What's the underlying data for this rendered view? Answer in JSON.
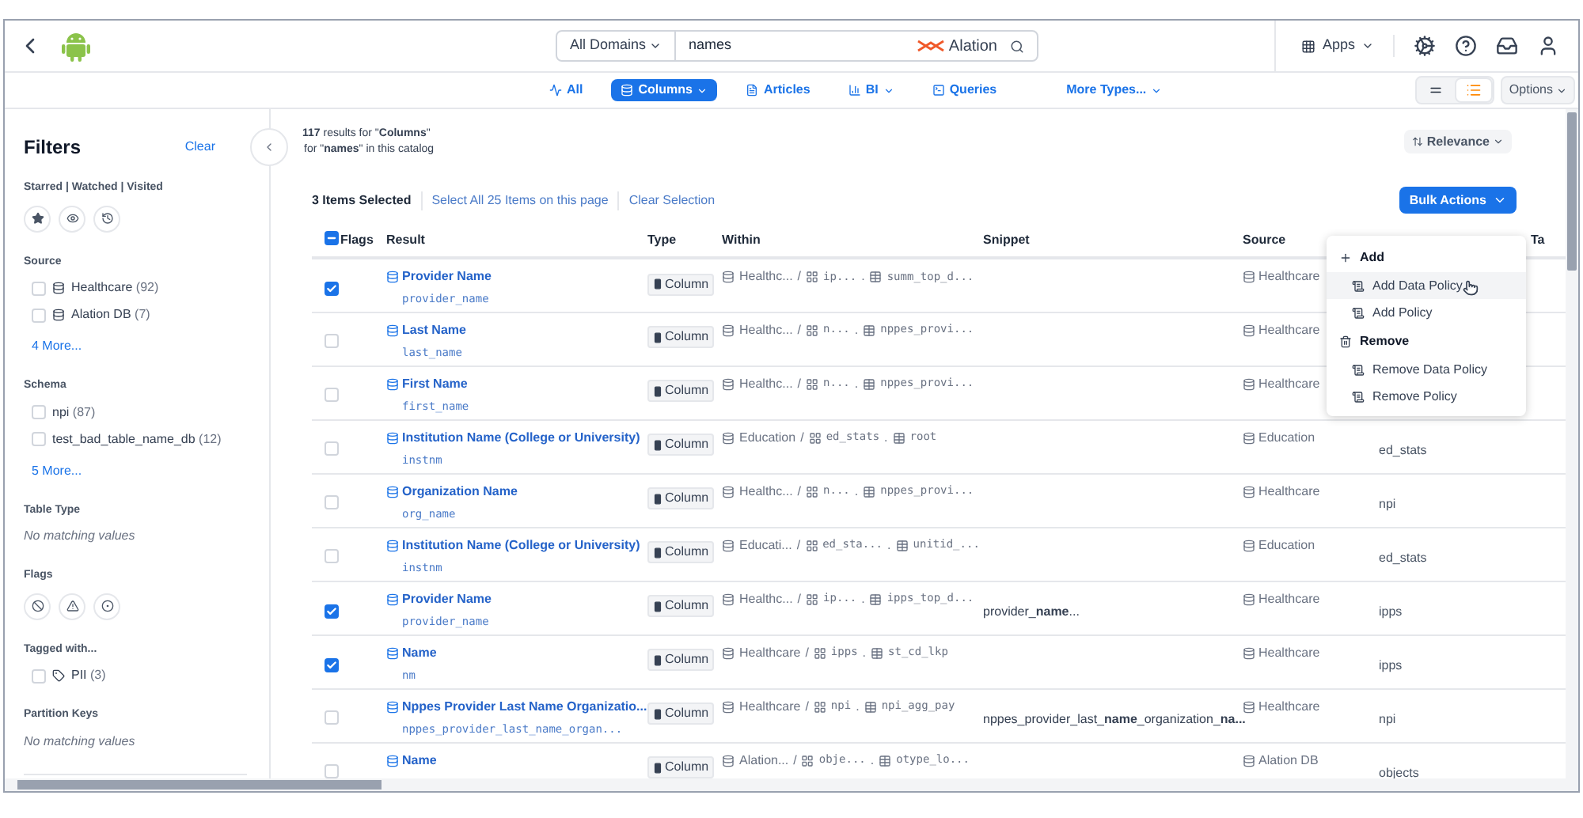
{
  "topbar": {
    "domain": "All Domains",
    "query": "names",
    "brand": "Alation",
    "apps": "Apps"
  },
  "type_tabs": [
    {
      "label": "All",
      "kind": "all",
      "caret": false,
      "selected": false
    },
    {
      "label": "Columns",
      "kind": "columns",
      "caret": true,
      "selected": true
    },
    {
      "label": "Articles",
      "kind": "articles",
      "caret": false,
      "selected": false
    },
    {
      "label": "BI",
      "kind": "bi",
      "caret": true,
      "selected": false
    },
    {
      "label": "Queries",
      "kind": "queries",
      "caret": false,
      "selected": false
    },
    {
      "label": "More Types...",
      "kind": "more",
      "caret": true,
      "selected": false
    }
  ],
  "view_toggle": [
    {
      "kind": "compact",
      "selected": false
    },
    {
      "kind": "detailed",
      "selected": true
    }
  ],
  "options": "Options",
  "filters": {
    "title": "Filters",
    "clear": "Clear",
    "sections": [
      {
        "kind": "starred",
        "title": "Starred | Watched | Visited"
      },
      {
        "kind": "checklist",
        "title": "Source",
        "items": [
          {
            "kind": "database",
            "label": "Healthcare",
            "count": "(92)",
            "checked": false
          },
          {
            "kind": "database",
            "label": "Alation DB",
            "count": "(7)",
            "checked": false
          }
        ],
        "more": "4 More..."
      },
      {
        "kind": "checklist",
        "title": "Schema",
        "items": [
          {
            "kind": "plain",
            "label": "npi",
            "count": "(87)",
            "checked": false
          },
          {
            "kind": "plain",
            "label": "test_bad_table_name_db",
            "count": "(12)",
            "checked": false
          }
        ],
        "more": "5 More..."
      },
      {
        "kind": "empty",
        "title": "Table Type",
        "note": "No matching values"
      },
      {
        "kind": "flags",
        "title": "Flags"
      },
      {
        "kind": "checklist",
        "title": "Tagged with...",
        "items": [
          {
            "kind": "tag",
            "label": "PII",
            "count": "(3)",
            "checked": false
          }
        ]
      },
      {
        "kind": "empty",
        "title": "Partition Keys",
        "note": "No matching values"
      }
    ]
  },
  "results": {
    "line_1": "**117** results for \"**Columns**\"",
    "line_2": "for \"**names**\" in this catalog",
    "sort": "Relevance"
  },
  "selection": {
    "count": "3 Items Selected",
    "select_all": "Select All 25 Items on this page",
    "clear": "Clear Selection",
    "bulk": "Bulk Actions"
  },
  "table": {
    "header_partial": true,
    "columns": [
      {
        "label": "Flags"
      },
      {
        "label": "Result"
      },
      {
        "label": "Type"
      },
      {
        "label": "Within"
      },
      {
        "label": "Snippet"
      },
      {
        "label": "Source"
      },
      {},
      {
        "label": "Ta"
      }
    ],
    "rows": [
      {
        "selected": true,
        "name": "Provider Name",
        "field": "provider_name",
        "type": "Column",
        "within": [
          {
            "kind": "database",
            "text": "Healthc..."
          },
          {
            "kind": "schema",
            "sep": "/",
            "text": "ip..."
          },
          {
            "kind": "table",
            "sep": ".",
            "text": "summ_top_d..."
          }
        ],
        "source": "Healthcare"
      },
      {
        "selected": false,
        "name": "Last Name",
        "field": "last_name",
        "type": "Column",
        "within": [
          {
            "kind": "database",
            "text": "Healthc..."
          },
          {
            "kind": "schema",
            "sep": "/",
            "text": "n..."
          },
          {
            "kind": "table",
            "sep": ".",
            "text": "nppes_provi..."
          }
        ],
        "source": "Healthcare"
      },
      {
        "selected": false,
        "name": "First Name",
        "field": "first_name",
        "type": "Column",
        "within": [
          {
            "kind": "database",
            "text": "Healthc..."
          },
          {
            "kind": "schema",
            "sep": "/",
            "text": "n..."
          },
          {
            "kind": "table",
            "sep": ".",
            "text": "nppes_provi..."
          }
        ],
        "source": "Healthcare"
      },
      {
        "selected": false,
        "name": "Institution Name (College or University)",
        "field": "instnm",
        "type": "Column",
        "within": [
          {
            "kind": "database",
            "text": "Education"
          },
          {
            "kind": "schema",
            "sep": "/",
            "text": "ed_stats"
          },
          {
            "kind": "table",
            "sep": ".",
            "text": "root"
          }
        ],
        "source": "Education",
        "column_7": "ed_stats"
      },
      {
        "selected": false,
        "name": "Organization Name",
        "field": "org_name",
        "type": "Column",
        "within": [
          {
            "kind": "database",
            "text": "Healthc..."
          },
          {
            "kind": "schema",
            "sep": "/",
            "text": "n..."
          },
          {
            "kind": "table",
            "sep": ".",
            "text": "nppes_provi..."
          }
        ],
        "source": "Healthcare",
        "column_7": "npi"
      },
      {
        "selected": false,
        "name": "Institution Name (College or University)",
        "field": "instnm",
        "type": "Column",
        "within": [
          {
            "kind": "database",
            "text": "Educati..."
          },
          {
            "kind": "schema",
            "sep": "/",
            "text": "ed_sta..."
          },
          {
            "kind": "table",
            "sep": ".",
            "text": "unitid_..."
          }
        ],
        "source": "Education",
        "column_7": "ed_stats"
      },
      {
        "selected": true,
        "name": "Provider Name",
        "field": "provider_name",
        "type": "Column",
        "within": [
          {
            "kind": "database",
            "text": "Healthc..."
          },
          {
            "kind": "schema",
            "sep": "/",
            "text": "ip..."
          },
          {
            "kind": "table",
            "sep": ".",
            "text": "ipps_top_d..."
          }
        ],
        "snippet": "provider_**name**...",
        "source": "Healthcare",
        "column_7": "ipps"
      },
      {
        "selected": true,
        "name": "Name",
        "field": "nm",
        "type": "Column",
        "within": [
          {
            "kind": "database",
            "text": "Healthcare"
          },
          {
            "kind": "schema",
            "sep": "/",
            "text": "ipps"
          },
          {
            "kind": "table",
            "sep": ".",
            "text": "st_cd_lkp"
          }
        ],
        "source": "Healthcare",
        "column_7": "ipps"
      },
      {
        "selected": false,
        "name": "Nppes Provider Last Name Organizatio...",
        "field": "nppes_provider_last_name_organ...",
        "type": "Column",
        "within": [
          {
            "kind": "database",
            "text": "Healthcare"
          },
          {
            "kind": "schema",
            "sep": "/",
            "text": "npi"
          },
          {
            "kind": "table",
            "sep": ".",
            "text": "npi_agg_pay"
          }
        ],
        "snippet": "nppes_provider_last_**name**_organization_**na...**",
        "source": "Healthcare",
        "column_7": "npi"
      },
      {
        "selected": false,
        "name": "Name",
        "type": "Column",
        "within": [
          {
            "kind": "database",
            "text": "Alation..."
          },
          {
            "kind": "schema",
            "sep": "/",
            "text": "obje..."
          },
          {
            "kind": "table",
            "sep": ".",
            "text": "otype_lo..."
          }
        ],
        "source": "Alation DB",
        "column_7": "objects"
      }
    ]
  },
  "menu": {
    "items": [
      {
        "kind": "add_group",
        "label": "Add"
      },
      {
        "kind": "action",
        "label": "Add Data Policy",
        "highlighted": true
      },
      {
        "kind": "action",
        "label": "Add Policy",
        "highlighted": false
      },
      {
        "kind": "remove_group",
        "label": "Remove"
      },
      {
        "kind": "action",
        "label": "Remove Data Policy",
        "highlighted": false
      },
      {
        "kind": "action",
        "label": "Remove Policy",
        "highlighted": false
      }
    ]
  }
}
